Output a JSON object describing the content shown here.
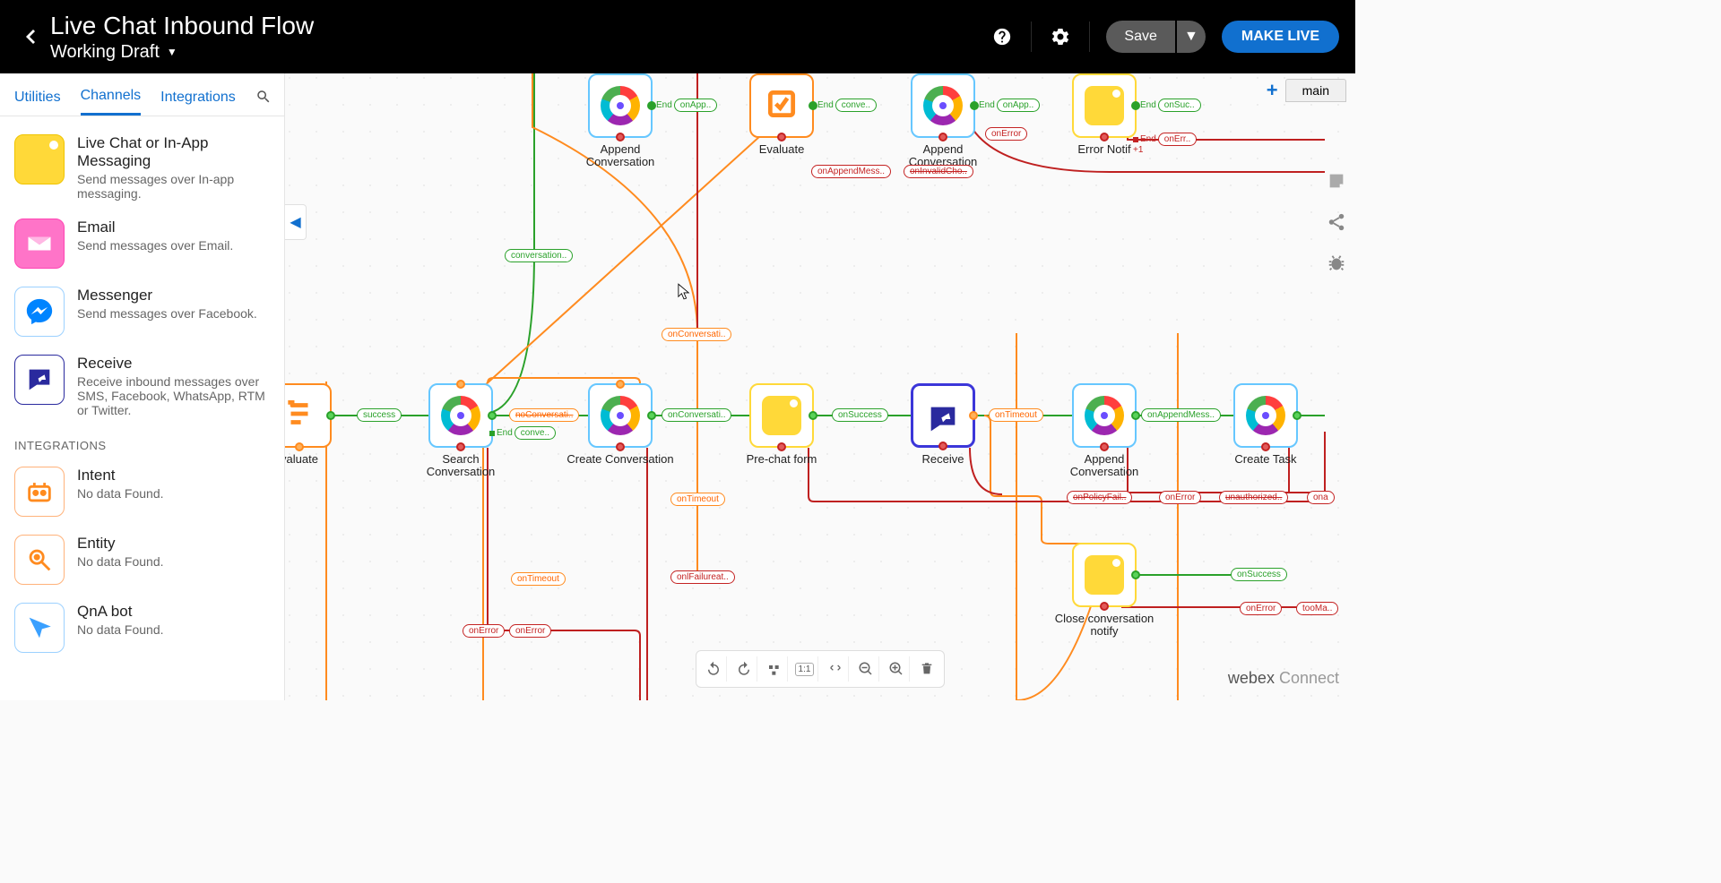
{
  "header": {
    "title": "Live Chat Inbound Flow",
    "subtitle": "Working Draft",
    "save": "Save",
    "make_live": "MAKE LIVE",
    "main_tab": "main"
  },
  "tabs": {
    "utilities": "Utilities",
    "channels": "Channels",
    "integrations": "Integrations"
  },
  "sidebar": {
    "items": [
      {
        "title": "Live Chat or In-App Messaging",
        "desc": "Send messages over In-app messaging."
      },
      {
        "title": "Email",
        "desc": "Send messages over Email."
      },
      {
        "title": "Messenger",
        "desc": "Send messages over Facebook."
      },
      {
        "title": "Receive",
        "desc": "Receive inbound messages over SMS, Facebook, WhatsApp, RTM or Twitter."
      }
    ],
    "integrations_hdr": "INTEGRATIONS",
    "integrations": [
      {
        "title": "Intent",
        "desc": "No data Found."
      },
      {
        "title": "Entity",
        "desc": "No data Found."
      },
      {
        "title": "QnA bot",
        "desc": "No data Found."
      }
    ]
  },
  "nodes": {
    "append1": "Append Conversation",
    "evaluate1": "Evaluate",
    "append2": "Append Conversation",
    "error": "Error Notif",
    "evaluate2": "valuate",
    "search": "Search Conversation",
    "create": "Create Conversation",
    "prechat": "Pre-chat form",
    "receive": "Receive",
    "append3": "Append Conversation",
    "task": "Create Task",
    "close": "Close conversation notify"
  },
  "edges": {
    "success": "success",
    "conversation": "conversation..",
    "noConversati": "noConversati..",
    "onConversati": "onConversati..",
    "onSuccess": "onSuccess",
    "onTimeout": "onTimeout",
    "onTimeout2": "onTimeout",
    "onAppendMess": "onAppendMess..",
    "onInvalidCho": "onInvalidCho..",
    "onError": "onError",
    "onErr": "onErr..",
    "onPolicyFail": "onPolicyFail..",
    "onFailureat": "onlFailureat..",
    "onApp": "onApp..",
    "conve": "conve..",
    "onSuc": "onSuc..",
    "End": "End",
    "unauthorized": "unauthorized..",
    "ona": "ona",
    "tooMa": "tooMa..",
    "plus1": "+1"
  },
  "brand": {
    "a": "webex",
    "b": "Connect"
  }
}
